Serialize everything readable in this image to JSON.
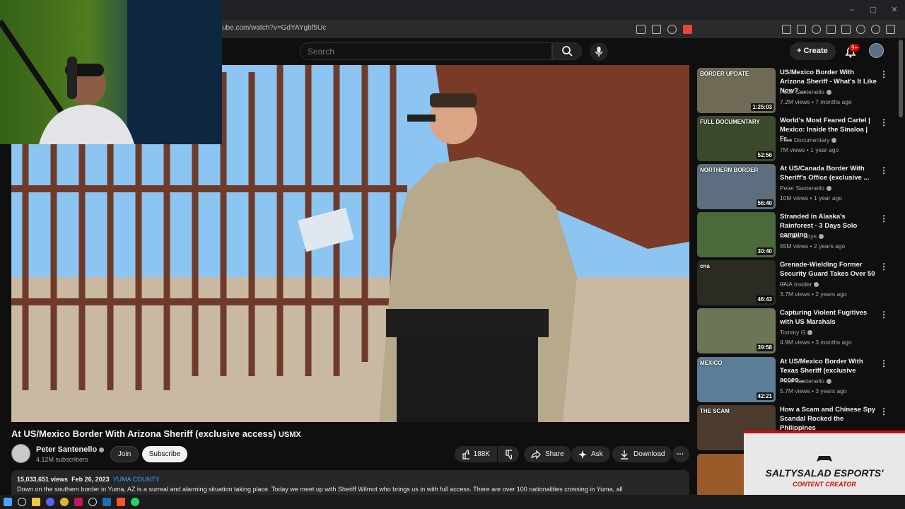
{
  "browser": {
    "url": "ube.com/watch?v=GdYAYgbf5Uc",
    "window_controls": [
      "–",
      "▢",
      "✕"
    ]
  },
  "header": {
    "search_placeholder": "Search",
    "create_label": "Create",
    "notifications_badge": "9+"
  },
  "video": {
    "title": "At US/Mexico Border With Arizona Sheriff (exclusive access)",
    "title_suffix": "USMX",
    "channel": "Peter Santenello",
    "subscribers": "4.12M subscribers",
    "join_label": "Join",
    "subscribe_label": "Subscribe",
    "likes": "188K",
    "share_label": "Share",
    "ask_label": "Ask",
    "download_label": "Download",
    "views": "15,033,651 views",
    "date": "Feb 26, 2023",
    "location_tag": "YUMA COUNTY",
    "description": "Down on the southern border in Yuma, AZ is a surreal and alarming situation taking place. Today we meet up with Sheriff Wilmot who brings us in with full access. There are over 100 nationalities crossing in Yuma, all"
  },
  "recommendations": [
    {
      "title": "US/Mexico Border With Arizona Sheriff - What's It Like Now? ...",
      "channel": "Peter Santenello",
      "meta": "7.2M views • 7 months ago",
      "duration": "1:25:03",
      "thumb_text": "BORDER UPDATE",
      "color": "#6f6a56"
    },
    {
      "title": "World's Most Feared Cartel | Mexico: Inside the Sinaloa | Fr...",
      "channel": "Free Documentary",
      "meta": "7M views • 1 year ago",
      "duration": "52:56",
      "thumb_text": "FULL DOCUMENTARY",
      "color": "#3c4a2c"
    },
    {
      "title": "At US/Canada Border With Sheriff's Office (exclusive ...",
      "channel": "Peter Santenello",
      "meta": "10M views • 1 year ago",
      "duration": "56:40",
      "thumb_text": "NORTHERN BORDER",
      "color": "#5d6f7e"
    },
    {
      "title": "Stranded in Alaska's Rainforest - 3 Days Solo camping",
      "channel": "Outdoor Boys",
      "meta": "55M views • 2 years ago",
      "duration": "30:40",
      "thumb_text": "",
      "color": "#4b6a3b"
    },
    {
      "title": "Grenade-Wielding Former Security Guard Takes Over 50 ...",
      "channel": "CNA Insider",
      "meta": "3.7M views • 2 years ago",
      "duration": "46:43",
      "thumb_text": "cna",
      "color": "#2b2b24"
    },
    {
      "title": "Capturing Violent Fugitives with US Marshals",
      "channel": "Tommy G",
      "meta": "4.9M views • 3 months ago",
      "duration": "39:58",
      "thumb_text": "",
      "color": "#6b7657"
    },
    {
      "title": "At US/Mexico Border With Texas Sheriff (exclusive acces...",
      "channel": "Peter Santenello",
      "meta": "5.7M views • 3 years ago",
      "duration": "42:21",
      "thumb_text": "MEXICO",
      "color": "#5b7d96"
    },
    {
      "title": "How a Scam and Chinese Spy Scandal Rocked the Philippines",
      "channel": "",
      "meta": "",
      "duration": "",
      "thumb_text": "THE SCAM",
      "color": "#4a3b2e"
    },
    {
      "title": "",
      "channel": "",
      "meta": "",
      "duration": "",
      "thumb_text": "",
      "color": "#9a5a2a"
    }
  ],
  "overlay": {
    "brand_name": "SALTYSALAD ESPORTS'",
    "brand_role": "CONTENT CREATOR"
  }
}
